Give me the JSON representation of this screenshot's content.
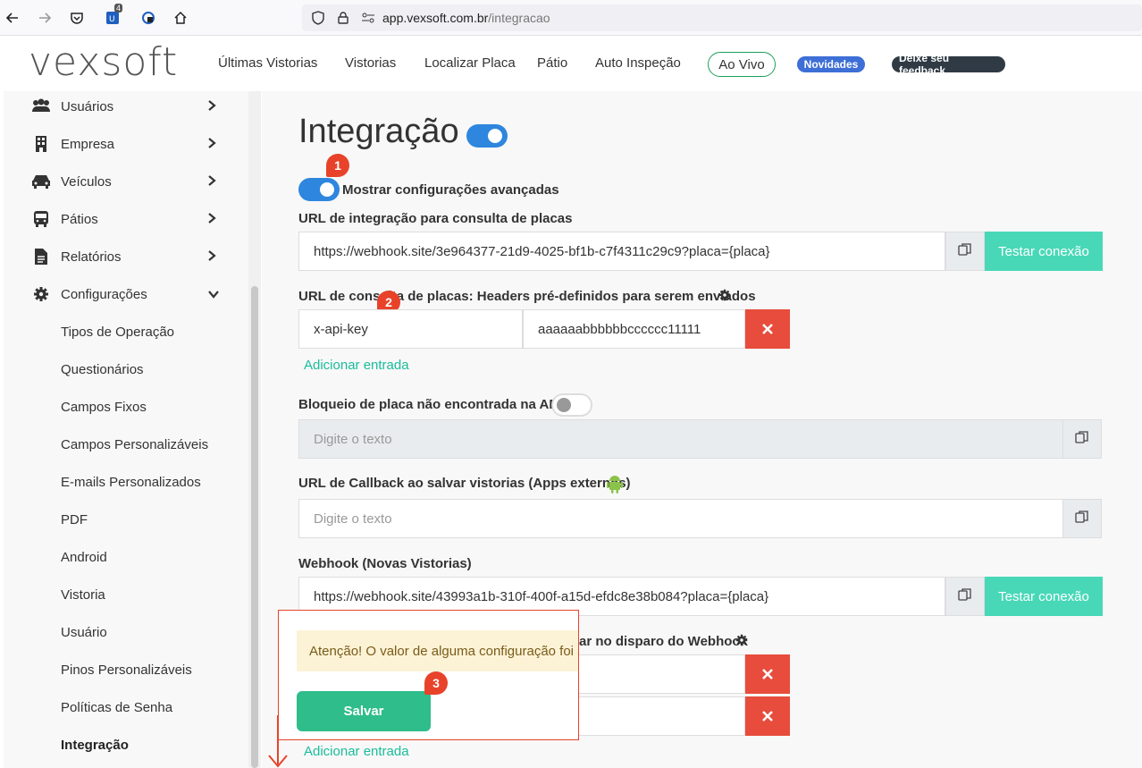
{
  "browser": {
    "url_host": "app.vexsoft.com.br",
    "url_path": "/integracao",
    "extension_badge": "4"
  },
  "header": {
    "logo_left": "ve",
    "logo_x": "x",
    "logo_right": "soft",
    "nav": [
      "Últimas Vistorias",
      "Vistorias",
      "Localizar Placa",
      "Pátio",
      "Auto Inspeção"
    ],
    "live_label": "Ao Vivo",
    "news_badge": "Novidades",
    "feedback_badge": "Deixe seu feedback",
    "colors": {
      "news": "#3d6fd6",
      "feedback": "#2f3a44",
      "live_border": "#1e9e5a"
    }
  },
  "sidebar": {
    "items": [
      {
        "label": "Usuários",
        "icon": "users-icon"
      },
      {
        "label": "Empresa",
        "icon": "building-icon"
      },
      {
        "label": "Veículos",
        "icon": "car-icon"
      },
      {
        "label": "Pátios",
        "icon": "bus-icon"
      },
      {
        "label": "Relatórios",
        "icon": "file-icon"
      },
      {
        "label": "Configurações",
        "icon": "gear-icon"
      }
    ],
    "sub_items": [
      "Tipos de Operação",
      "Questionários",
      "Campos Fixos",
      "Campos Personalizáveis",
      "E-mails Personalizados",
      "PDF",
      "Android",
      "Vistoria",
      "Usuário",
      "Pinos Personalizáveis",
      "Políticas de Senha",
      "Integração"
    ],
    "active": "Integração"
  },
  "main": {
    "title": "Integração",
    "title_toggle_on": true,
    "advanced_label": "Mostrar configurações avançadas",
    "advanced_on": true,
    "url_label": "URL de integração para consulta de placas",
    "url_value": "https://webhook.site/3e964377-21d9-4025-bf1b-c7f4311c29c9?placa={placa}",
    "test_label": "Testar conexão",
    "headers_label": "URL de consulta de placas: Headers pré-definidos para serem enviados",
    "header_key": "x-api-key",
    "header_value": "aaaaaabbbbbbcccccc11111",
    "add_entry": "Adicionar entrada",
    "block_label": "Bloqueio de placa não encontrada na API",
    "block_on": false,
    "placeholder": "Digite o texto",
    "callback_label": "URL de Callback ao salvar vistorias (Apps externos)",
    "webhook_label": "Webhook (Novas Vistorias)",
    "webhook_value": "https://webhook.site/43993a1b-310f-400f-a15d-efdc8e38b084?placa={placa}",
    "webhook_headers_label_tail": "ar no disparo do Webhook",
    "alert_text": "Atenção! O valor de alguma configuração foi al",
    "save_label": "Salvar",
    "markers": [
      "1",
      "2",
      "3"
    ],
    "colors": {
      "toggle_on": "#2e86de",
      "test_btn": "#48d8b8",
      "delete_btn": "#e74c3c",
      "save_btn": "#2ebd8b",
      "marker": "#e8432a",
      "link": "#1abc9c"
    }
  }
}
